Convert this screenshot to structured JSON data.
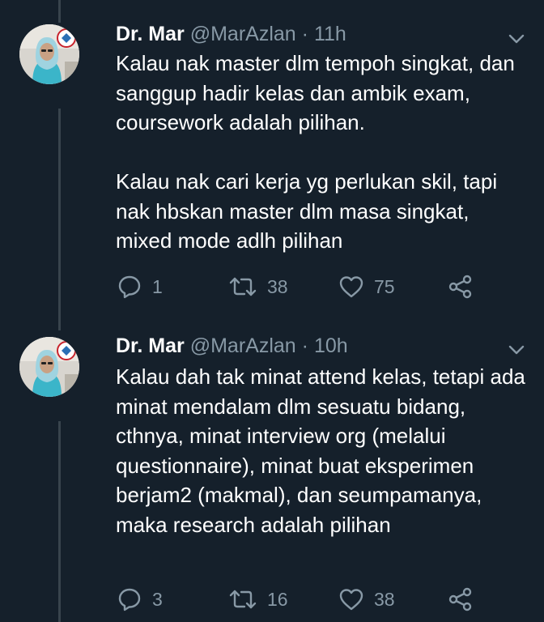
{
  "tweets": [
    {
      "name": "Dr. Mar",
      "handle": "@MarAzlan",
      "separator": "·",
      "time": "11h",
      "text": "Kalau nak master dlm tempoh singkat, dan sanggup hadir kelas dan ambik exam, coursework adalah pilihan.\n\nKalau nak cari kerja yg perlukan skil, tapi nak hbskan master dlm masa singkat, mixed mode adlh pilihan",
      "replies": "1",
      "retweets": "38",
      "likes": "75"
    },
    {
      "name": "Dr. Mar",
      "handle": "@MarAzlan",
      "separator": "·",
      "time": "10h",
      "text": "Kalau dah tak minat attend kelas, tetapi ada minat mendalam dlm sesuatu bidang, cthnya, minat interview org (melalui questionnaire), minat buat eksperimen berjam2 (makmal), dan seumpamanya, maka research adalah pilihan",
      "replies": "3",
      "retweets": "16",
      "likes": "38"
    }
  ],
  "icons": {
    "reply": "reply-icon",
    "retweet": "retweet-icon",
    "like": "heart-icon",
    "share": "share-icon",
    "more": "chevron-down-icon"
  },
  "colors": {
    "background": "#15202b",
    "text": "#ffffff",
    "muted": "#8899a6",
    "thread_line": "#38444d"
  }
}
